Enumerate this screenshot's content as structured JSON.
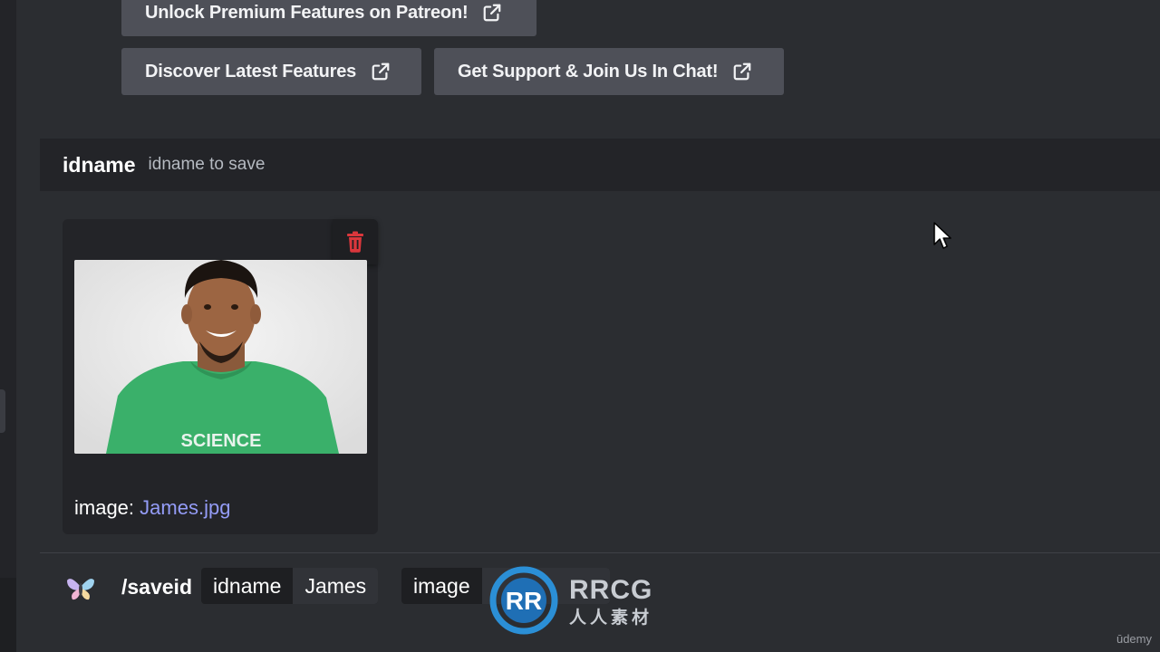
{
  "links": {
    "patreon": "Unlock Premium Features on Patreon!",
    "features": "Discover Latest Features",
    "support": "Get Support & Join Us In Chat!"
  },
  "form": {
    "field_name": "idname",
    "field_description": "idname to save"
  },
  "upload": {
    "caption_prefix": "image:",
    "file_name": "James.jpg",
    "photo_shirt_text": "SCIENCE"
  },
  "command": {
    "name": "/saveid",
    "options": [
      {
        "key": "idname",
        "value": "James"
      },
      {
        "key": "image",
        "value": ""
      }
    ]
  },
  "watermark": {
    "brand": "RRCG",
    "sub": "人人素材"
  },
  "footer": {
    "udemy": "ūdemy"
  },
  "colors": {
    "link_button": "#4e5058",
    "danger": "#da373c",
    "link_text": "#949cf7",
    "background": "#2b2d31"
  }
}
